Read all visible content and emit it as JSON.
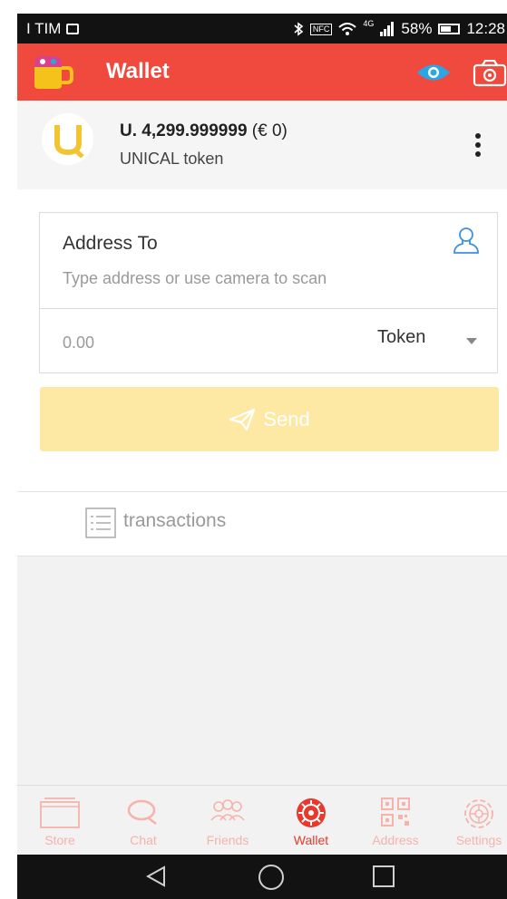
{
  "status_bar": {
    "carrier": "I TIM",
    "network": "4G",
    "battery": "58%",
    "time": "12:28",
    "nfc": "NFC"
  },
  "app_bar": {
    "title": "Wallet",
    "icons": [
      "mug-logo-icon",
      "eye-icon",
      "camera-icon"
    ]
  },
  "token": {
    "symbol": "U.",
    "amount": "4,299.999999",
    "fiat": "(€ 0)",
    "name": "UNICAL token",
    "avatar_letter": "U"
  },
  "form": {
    "address_label": "Address To",
    "address_placeholder": "Type address or use camera to scan",
    "amount_placeholder": "0.00",
    "token_select": "Token",
    "send_label": "Send"
  },
  "transactions": {
    "label": "transactions"
  },
  "bottom_nav": {
    "items": [
      {
        "label": "Store",
        "icon": "store-icon"
      },
      {
        "label": "Chat",
        "icon": "chat-icon"
      },
      {
        "label": "Friends",
        "icon": "friends-icon"
      },
      {
        "label": "Wallet",
        "icon": "wallet-icon",
        "active": true
      },
      {
        "label": "Address",
        "icon": "qr-code-icon"
      },
      {
        "label": "Settings",
        "icon": "gear-icon"
      }
    ]
  },
  "colors": {
    "primary": "#ef4a3d",
    "send_disabled": "#fde9a4",
    "nav_active": "#e8392c",
    "nav_inactive": "#f6b2ab"
  }
}
